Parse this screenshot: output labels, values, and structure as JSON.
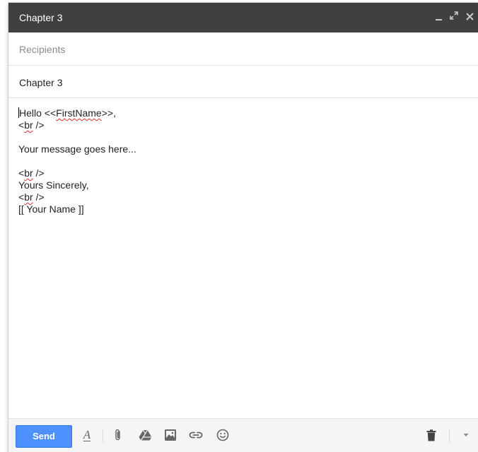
{
  "window": {
    "title": "Chapter 3"
  },
  "compose": {
    "recipients_placeholder": "Recipients",
    "subject": "Chapter 3"
  },
  "body": {
    "hello_prefix": "Hello <<",
    "firstname": "FirstName",
    "hello_suffix": ">>,",
    "br_open": "<",
    "br_word": "br",
    "br_close": " />",
    "message": "Your message goes here...",
    "sincerely": "Yours Sincerely,",
    "your_name": "[[ Your Name ]]"
  },
  "toolbar": {
    "send_label": "Send",
    "icons": [
      "formatting-icon",
      "attach-icon",
      "drive-icon",
      "photo-icon",
      "link-icon",
      "emoji-icon",
      "trash-icon",
      "more-options-icon"
    ]
  },
  "colors": {
    "titlebar": "#404040",
    "send_button": "#4d90fe",
    "spellcheck": "#d93025"
  }
}
